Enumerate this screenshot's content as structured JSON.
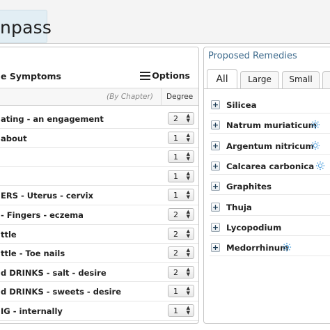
{
  "header": {
    "title_fragment": "npass"
  },
  "symptoms_panel": {
    "title": "e Symptoms",
    "options_label": "Options",
    "col_chapter": "(By Chapter)",
    "col_degree": "Degree",
    "rows": [
      {
        "text": "ating - an engagement",
        "degree": "2"
      },
      {
        "text": "about",
        "degree": "1"
      },
      {
        "text": "",
        "degree": "1"
      },
      {
        "text": "",
        "degree": "1"
      },
      {
        "text": "ERS - Uterus - cervix",
        "degree": "1"
      },
      {
        "text": "- Fingers - eczema",
        "degree": "2"
      },
      {
        "text": "ttle",
        "degree": "2"
      },
      {
        "text": "ttle - Toe nails",
        "degree": "2"
      },
      {
        "text": "d DRINKS - salt - desire",
        "degree": "2"
      },
      {
        "text": "d DRINKS - sweets - desire",
        "degree": "1"
      },
      {
        "text": "IG - internally",
        "degree": "1"
      }
    ]
  },
  "remedies_panel": {
    "title": "Proposed Remedies",
    "tabs": [
      {
        "label": "All",
        "active": true
      },
      {
        "label": "Large",
        "active": false
      },
      {
        "label": "Small",
        "active": false
      },
      {
        "label": "",
        "active": false
      }
    ],
    "remedies": [
      {
        "name": "Silicea",
        "icon": ""
      },
      {
        "name": "Natrum muriaticum",
        "icon": "sun-icon"
      },
      {
        "name": "Argentum nitricum",
        "icon": "sun-icon"
      },
      {
        "name": "Calcarea carbonica",
        "icon": "sun-icon"
      },
      {
        "name": "Graphites",
        "icon": ""
      },
      {
        "name": "Thuja",
        "icon": ""
      },
      {
        "name": "Lycopodium",
        "icon": ""
      },
      {
        "name": "Medorrhinum",
        "icon": "sun-icon"
      }
    ]
  },
  "colors": {
    "accent": "#3d6a8c",
    "icon_blue": "#5aa6e0"
  }
}
